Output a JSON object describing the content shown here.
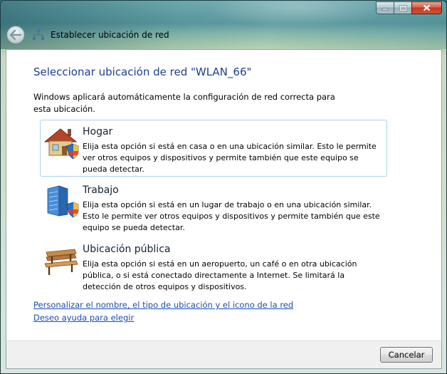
{
  "window": {
    "title": "Establecer ubicación de red"
  },
  "page": {
    "heading": "Seleccionar ubicación de red \"WLAN_66\"",
    "intro": "Windows aplicará automáticamente la configuración de red correcta para esta ubicación."
  },
  "options": [
    {
      "title": "Hogar",
      "description": "Elija esta opción si está en casa o en una ubicación similar. Esto le permite ver otros equipos y dispositivos y permite también que este equipo se pueda detectar.",
      "icon": "home-icon"
    },
    {
      "title": "Trabajo",
      "description": "Elija esta opción si está en un lugar de trabajo o en una ubicación similar. Esto le permite ver otros equipos y dispositivos y permite también que este equipo se pueda detectar.",
      "icon": "office-building-icon"
    },
    {
      "title": "Ubicación pública",
      "description": "Elija esta opción si está en un aeropuerto, un café o en otra ubicación pública, o si está conectado directamente a Internet. Se limitará la detección de otros equipos y dispositivos.",
      "icon": "park-bench-icon"
    }
  ],
  "links": {
    "customize": "Personalizar el nombre, el tipo de ubicación y el icono de la red",
    "help": "Deseo ayuda para elegir"
  },
  "footer": {
    "cancel": "Cancelar"
  },
  "colors": {
    "heading": "#1e3f8f",
    "link": "#1b4ea8",
    "selection_border": "#a8d4ee"
  }
}
